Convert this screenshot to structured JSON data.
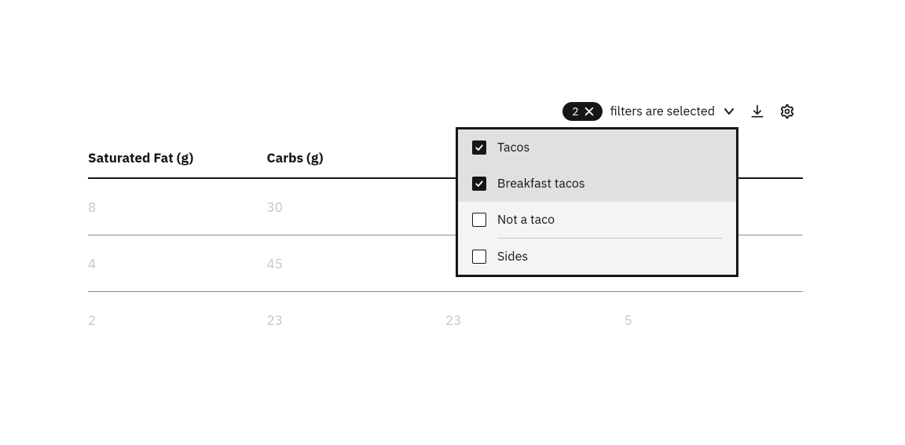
{
  "filter": {
    "count": "2",
    "summary_label": "filters are selected",
    "options": [
      {
        "label": "Tacos",
        "checked": true
      },
      {
        "label": "Breakfast tacos",
        "checked": true
      },
      {
        "label": "Not a taco",
        "checked": false
      },
      {
        "label": "Sides",
        "checked": false
      }
    ]
  },
  "table": {
    "columns": [
      "Saturated Fat (g)",
      "Carbs (g)",
      "",
      ""
    ],
    "rows": [
      {
        "c0": "8",
        "c1": "30",
        "c2": "",
        "c3": ""
      },
      {
        "c0": "4",
        "c1": "45",
        "c2": "",
        "c3": ""
      },
      {
        "c0": "2",
        "c1": "23",
        "c2": "23",
        "c3": "5"
      }
    ]
  }
}
